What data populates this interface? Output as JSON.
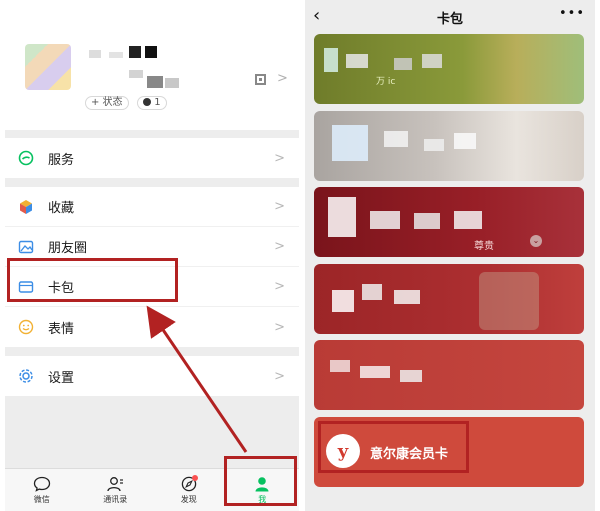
{
  "left": {
    "profile": {
      "status_button": "+ 状态",
      "status_count": "1"
    },
    "menu": [
      {
        "key": "services",
        "label": "服务"
      },
      {
        "key": "favorites",
        "label": "收藏"
      },
      {
        "key": "moments",
        "label": "朋友圈"
      },
      {
        "key": "cards",
        "label": "卡包"
      },
      {
        "key": "stickers",
        "label": "表情"
      },
      {
        "key": "settings",
        "label": "设置"
      }
    ],
    "tabs": [
      {
        "key": "chats",
        "label": "微信"
      },
      {
        "key": "contacts",
        "label": "通讯录"
      },
      {
        "key": "discover",
        "label": "发现"
      },
      {
        "key": "me",
        "label": "我"
      }
    ]
  },
  "right": {
    "title": "卡包",
    "back_icon": "chevron-left-icon",
    "more_icon": "more-dots-icon",
    "cards": [
      {
        "key": "card-1",
        "color": "#7d8a2f",
        "text": "万 ic"
      },
      {
        "key": "card-2",
        "color": "#b7b3ae",
        "text": ""
      },
      {
        "key": "card-3",
        "color": "#8e1e24",
        "text": "尊贵"
      },
      {
        "key": "card-4",
        "color": "#a32a2d",
        "text": ""
      },
      {
        "key": "card-5",
        "color": "#c5463e",
        "text": ""
      },
      {
        "key": "card-6",
        "color": "#cf4a3c",
        "text": "意尔康会员卡"
      }
    ]
  },
  "colors": {
    "highlight": "#b22222",
    "accent": "#07c160"
  }
}
